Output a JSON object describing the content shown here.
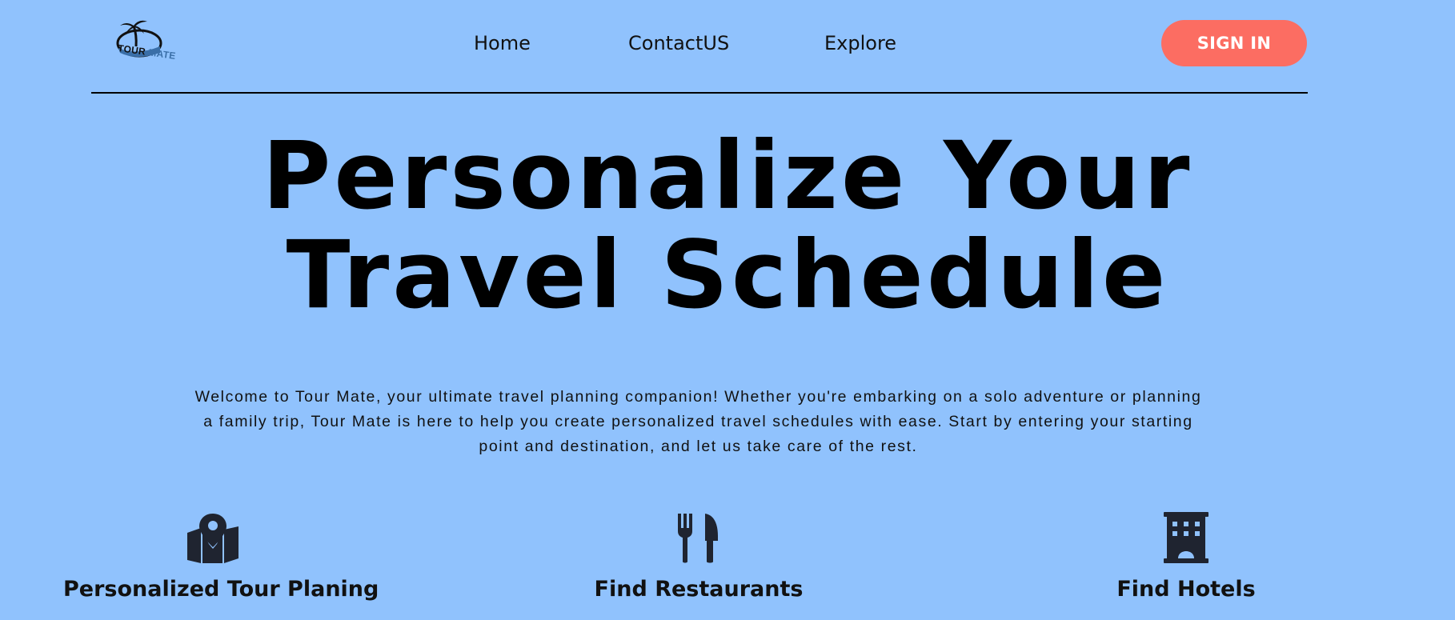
{
  "brand": {
    "logo_line1": "TOUR",
    "logo_line2": "MATE",
    "logo_icon": "palm-tree-icon"
  },
  "nav": {
    "items": [
      {
        "label": "Home"
      },
      {
        "label": "ContactUS"
      },
      {
        "label": "Explore"
      }
    ],
    "signin_label": "SIGN IN"
  },
  "hero": {
    "title_line1": "Personalize Your",
    "title_line2": "Travel Schedule",
    "intro": "Welcome to Tour Mate, your ultimate travel planning companion! Whether you're embarking on a solo adventure or planning a family trip, Tour Mate is here to help you create personalized travel schedules with ease. Start by entering your starting point and destination, and let us take care of the rest."
  },
  "features": [
    {
      "icon": "map-location-icon",
      "title": "Personalized Tour Planing"
    },
    {
      "icon": "utensils-icon",
      "title": "Find Restaurants"
    },
    {
      "icon": "hotel-icon",
      "title": "Find Hotels"
    }
  ],
  "colors": {
    "background": "#90c2fd",
    "accent": "#fc6d62",
    "text": "#000000",
    "icon": "#1f2430"
  }
}
